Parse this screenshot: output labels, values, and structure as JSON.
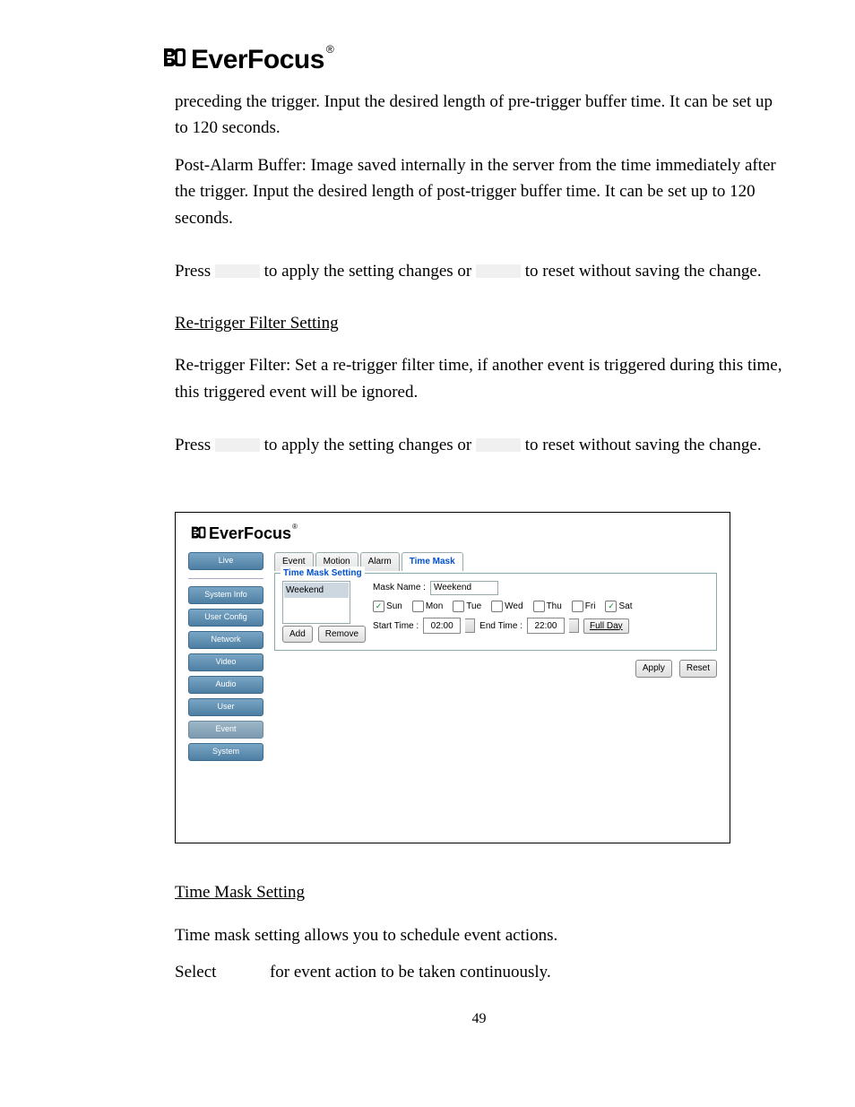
{
  "logo_text": "EverFocus",
  "logo_reg": "®",
  "para1": "preceding the trigger. Input the desired length of pre-trigger buffer time. It can be set up to 120 seconds.",
  "para2": "Post-Alarm Buffer: Image saved internally in the server from the time immediately after the trigger. Input the desired length of post-trigger buffer time. It can be set up to 120 seconds.",
  "press_pre": "Press ",
  "press_mid": " to apply the setting changes or ",
  "press_post": " to reset without saving the change.",
  "subhead1": "Re-trigger Filter Setting",
  "para3": "Re-trigger Filter: Set a re-trigger filter time, if another event is triggered during this time, this triggered event will be ignored.",
  "subhead2": "Time Mask Setting",
  "para4": "Time mask setting allows you to schedule event actions.",
  "para5_pre": "Select ",
  "para5_post": " for event action to be taken continuously.",
  "page_num": "49",
  "ss": {
    "logo_text": "EverFocus",
    "logo_reg": "®",
    "sidebar": {
      "live": "Live",
      "items": [
        "System Info",
        "User Config",
        "Network",
        "Video",
        "Audio",
        "User",
        "Event",
        "System"
      ]
    },
    "tabs": [
      "Event",
      "Motion",
      "Alarm",
      "Time Mask"
    ],
    "active_tab_index": 3,
    "fieldset_legend": "Time Mask Setting",
    "list_items": [
      "Weekend"
    ],
    "add_btn": "Add",
    "remove_btn": "Remove",
    "mask_name_label": "Mask Name :",
    "mask_name_value": "Weekend",
    "days": [
      {
        "label": "Sun",
        "on": true
      },
      {
        "label": "Mon",
        "on": false
      },
      {
        "label": "Tue",
        "on": false
      },
      {
        "label": "Wed",
        "on": false
      },
      {
        "label": "Thu",
        "on": false
      },
      {
        "label": "Fri",
        "on": false
      },
      {
        "label": "Sat",
        "on": true
      }
    ],
    "start_label": "Start Time :",
    "start_value": "02:00",
    "end_label": "End Time :",
    "end_value": "22:00",
    "fullday_btn": "Full Day",
    "apply_btn": "Apply",
    "reset_btn": "Reset"
  }
}
